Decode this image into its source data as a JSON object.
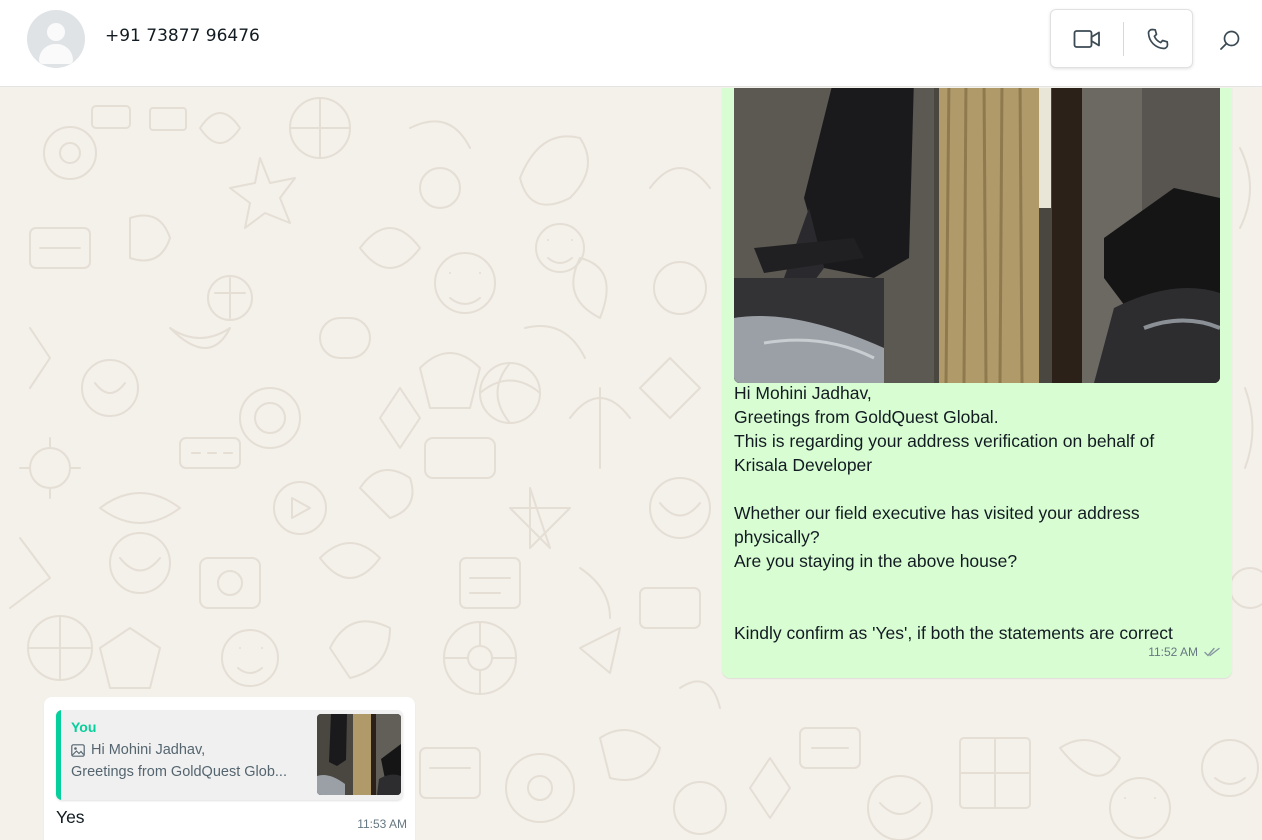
{
  "header": {
    "contact_name": "+91 73877 96476",
    "video_call_icon": "video-camera-icon",
    "voice_call_icon": "phone-icon",
    "search_icon": "search-icon"
  },
  "messages": {
    "outgoing": {
      "image": "photo of a room with curtain and scooter",
      "lines": [
        "Hi Mohini Jadhav,",
        "Greetings from GoldQuest Global.",
        "This is regarding your address verification on behalf of",
        "Krisala Developer",
        "",
        "Whether our field executive has visited your address",
        "physically?",
        "Are you staying in the above house?",
        "",
        "",
        "Kindly confirm as 'Yes', if both the statements are correct"
      ],
      "time": "11:52 AM",
      "status_icon": "double-check-icon"
    },
    "incoming": {
      "quote": {
        "author": "You",
        "line1": "Hi Mohini Jadhav,",
        "line2": "Greetings from GoldQuest Glob...",
        "media_icon": "image-icon"
      },
      "text": "Yes",
      "time": "11:53 AM"
    }
  },
  "colors": {
    "outgoing_bubble": "#d9fdd3",
    "incoming_bubble": "#ffffff",
    "accent": "#06cf9c",
    "background": "#f4f0ea"
  }
}
